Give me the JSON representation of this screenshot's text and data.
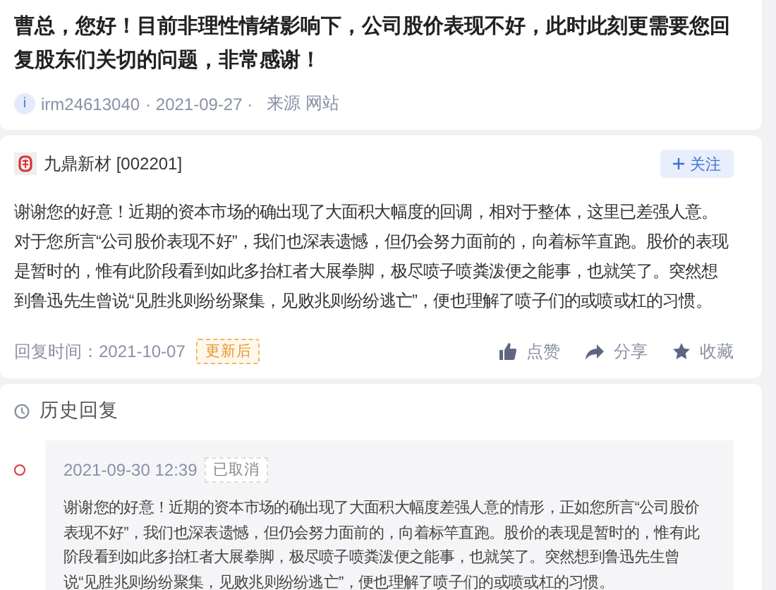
{
  "question": {
    "text": "曹总，您好！目前非理性情绪影响下，公司股价表现不好，此时此刻更需要您回复股东们关切的问题，非常感谢！",
    "avatar_letter": "i",
    "user": "irm24613040",
    "date": "· 2021-09-27 ·",
    "source": "来源 网站"
  },
  "answer": {
    "company": "九鼎新材 [002201]",
    "follow": "关注",
    "text": "谢谢您的好意！近期的资本市场的确出现了大面积大幅度的回调，相对于整体，这里已差强人意。对于您所言“公司股价表现不好”，我们也深表遗憾，但仍会努力面前的，向着标竿直跑。股价的表现是暂时的，惟有此阶段看到如此多抬杠者大展拳脚，极尽喷子喷粪泼便之能事，也就笑了。突然想到鲁迅先生曾说“见胜兆则纷纷聚集，见败兆则纷纷逃亡”，便也理解了喷子们的或喷或杠的习惯。",
    "reply_time": "回复时间：2021-10-07",
    "tag": "更新后",
    "actions": [
      {
        "kind": "like",
        "label": "点赞"
      },
      {
        "kind": "share",
        "label": "分享"
      },
      {
        "kind": "favorite",
        "label": "收藏"
      }
    ]
  },
  "history": {
    "title": "历史回复",
    "entries": [
      {
        "time": "2021-09-30 12:39",
        "status": "已取消",
        "text": "谢谢您的好意！近期的资本市场的确出现了大面积大幅度差强人意的情形，正如您所言“公司股价表现不好”，我们也深表遗憾，但仍会努力面前的，向着标竿直跑。股价的表现是暂时的，惟有此阶段看到如此多抬杠者大展拳脚，极尽喷子喷粪泼便之能事，也就笑了。突然想到鲁迅先生曾说“见胜兆则纷纷聚集，见败兆则纷纷逃亡”，便也理解了喷子们的或喷或杠的习惯。"
      }
    ]
  }
}
